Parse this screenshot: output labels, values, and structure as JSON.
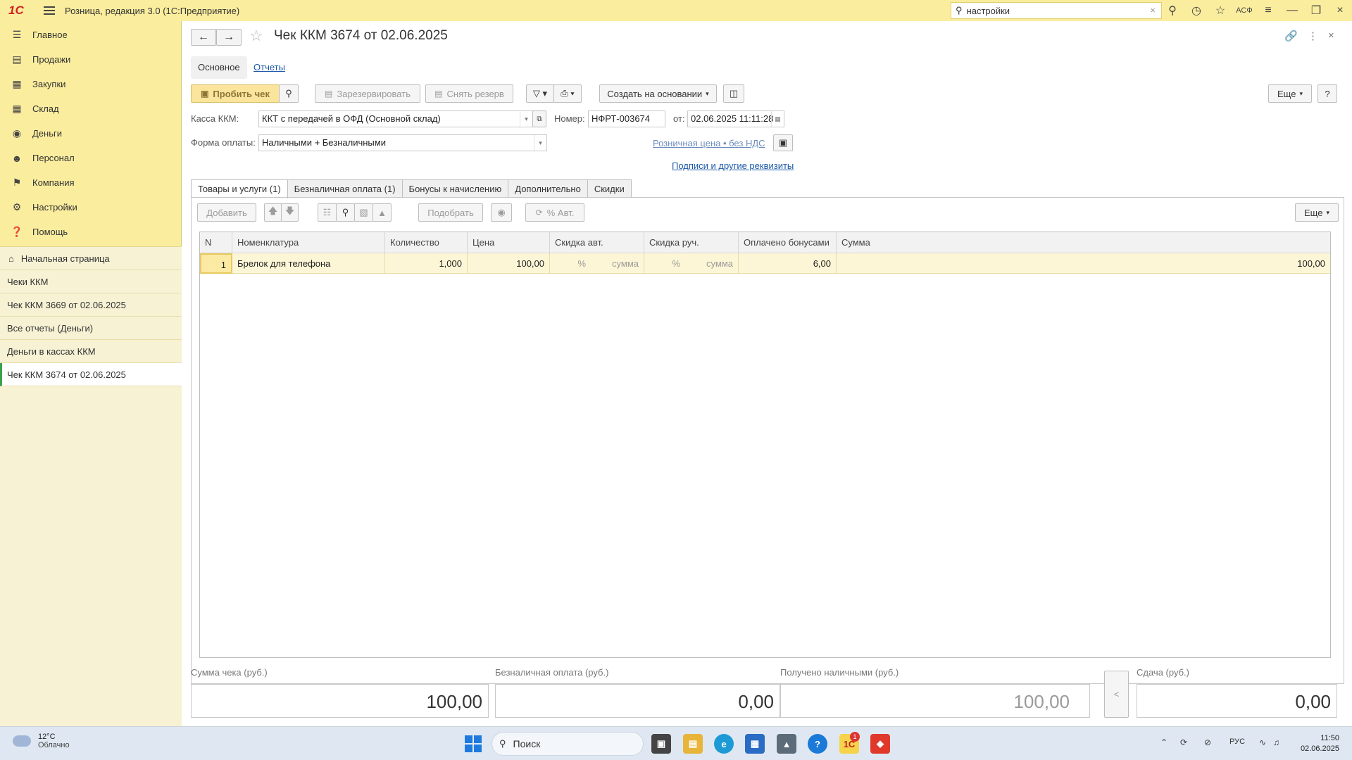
{
  "titlebar": {
    "logo": "1С",
    "app_title": "Розница, редакция 3.0  (1С:Предприятие)",
    "search_value": "настройки",
    "user_initials": "АСФ"
  },
  "sidebar": {
    "nav": [
      {
        "label": "Главное",
        "icon": "menu-icon"
      },
      {
        "label": "Продажи",
        "icon": "cart-icon"
      },
      {
        "label": "Закупки",
        "icon": "purchase-icon"
      },
      {
        "label": "Склад",
        "icon": "warehouse-icon"
      },
      {
        "label": "Деньги",
        "icon": "money-icon"
      },
      {
        "label": "Персонал",
        "icon": "people-icon"
      },
      {
        "label": "Компания",
        "icon": "flag-icon"
      },
      {
        "label": "Настройки",
        "icon": "gear-icon"
      },
      {
        "label": "Помощь",
        "icon": "help-icon"
      }
    ],
    "open": [
      {
        "label": "Начальная страница"
      },
      {
        "label": "Чеки ККМ"
      },
      {
        "label": "Чек ККМ 3669 от 02.06.2025"
      },
      {
        "label": "Все отчеты (Деньги)"
      },
      {
        "label": "Деньги в кассах ККМ"
      },
      {
        "label": "Чек ККМ 3674 от 02.06.2025"
      }
    ]
  },
  "doc": {
    "title": "Чек ККМ 3674 от 02.06.2025",
    "tab_main": "Основное",
    "tab_reports": "Отчеты"
  },
  "toolbar": {
    "print_receipt": "Пробить чек",
    "reserve": "Зарезервировать",
    "unreserve": "Снять резерв",
    "create_based": "Создать на основании",
    "more": "Еще",
    "help": "?"
  },
  "form": {
    "kkm_label": "Касса ККМ:",
    "kkm_value": "ККТ с передачей в ОФД (Основной склад)",
    "number_label": "Номер:",
    "number_value": "НФРТ-003674",
    "date_label": "от:",
    "date_value": "02.06.2025 11:11:28",
    "payment_label": "Форма оплаты:",
    "payment_value": "Наличными + Безналичными",
    "price_link": "Розничная цена • без НДС",
    "signatures_link": "Подписи и другие реквизиты"
  },
  "tabs": [
    "Товары и услуги (1)",
    "Безналичная оплата (1)",
    "Бонусы к начислению",
    "Дополнительно",
    "Скидки"
  ],
  "table_toolbar": {
    "add": "Добавить",
    "pick": "Подобрать",
    "auto": "% Авт.",
    "more": "Еще"
  },
  "table": {
    "columns": [
      "N",
      "Номенклатура",
      "Количество",
      "Цена",
      "Скидка авт.",
      "Скидка руч.",
      "Оплачено бонусами",
      "Сумма"
    ],
    "rows": [
      {
        "n": "1",
        "item": "Брелок для телефона",
        "qty": "1,000",
        "price": "100,00",
        "auto_pct": "%",
        "auto_sum": "сумма",
        "man_pct": "%",
        "man_sum": "сумма",
        "bonus": "6,00",
        "sum": "100,00"
      }
    ]
  },
  "totals": {
    "check_label": "Сумма чека (руб.)",
    "check_value": "100,00",
    "card_label": "Безналичная оплата (руб.)",
    "card_value": "0,00",
    "cash_label": "Получено наличными (руб.)",
    "cash_value": "100,00",
    "change_label": "Сдача (руб.)",
    "change_value": "0,00"
  },
  "taskbar": {
    "temp": "12°C",
    "weather": "Облачно",
    "search_placeholder": "Поиск",
    "lang": "РУС",
    "time": "11:50",
    "date": "02.06.2025",
    "badge": "1"
  }
}
